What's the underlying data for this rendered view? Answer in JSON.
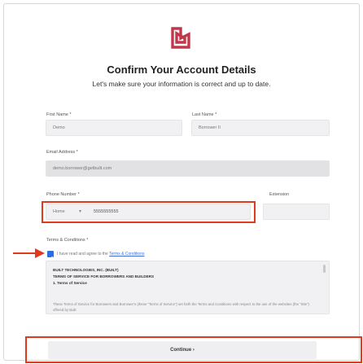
{
  "header": {
    "title": "Confirm Your Account Details",
    "subtitle": "Let's make sure your information is correct and up to date."
  },
  "form": {
    "first_name": {
      "label": "First Name *",
      "value": "Demo"
    },
    "last_name": {
      "label": "Last Name *",
      "value": "Borrower II"
    },
    "email": {
      "label": "Email Address *",
      "value": "demo.borrower@getbuilt.com"
    },
    "phone": {
      "label": "Phone Number *",
      "type": "Home",
      "value": "5555555555"
    },
    "extension": {
      "label": "Extension",
      "value": ""
    }
  },
  "terms": {
    "label": "Terms & Conditions *",
    "agree_prefix": "I have read and agree to the",
    "agree_link": "Terms & Conditions",
    "checked": true,
    "lines": [
      "BUILT TECHNOLOGIES, INC. (BUILT)",
      "TERMS OF SERVICE FOR BORROWERS AND BUILDERS",
      "1. Terms of Service"
    ],
    "body": "These Terms of Service for Borrowers and Borrower’s (these “Terms of Service”) set forth the Terms and Conditions with respect to the use of the websites (the “Site”) offered by Built"
  },
  "actions": {
    "continue_label": "Continue ›"
  },
  "colors": {
    "brand": "#c0394b",
    "highlight": "#e03a1e",
    "link": "#3d6fd6"
  }
}
